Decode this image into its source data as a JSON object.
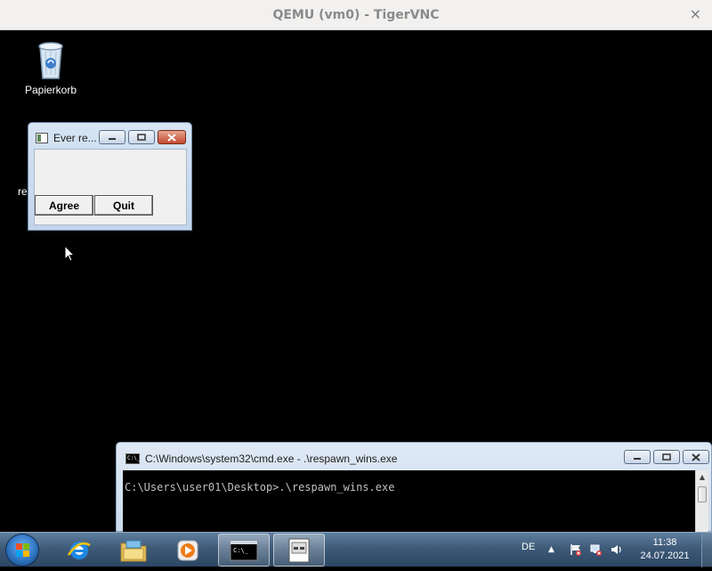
{
  "vnc": {
    "title": "QEMU (vm0) - TigerVNC",
    "close_glyph": "×"
  },
  "desktop": {
    "recycle_bin_label": "Papierkorb",
    "partial_icon_label": "re"
  },
  "dialog": {
    "title": "Ever re...",
    "agree_label": "Agree",
    "quit_label": "Quit"
  },
  "cmd": {
    "title": "C:\\Windows\\system32\\cmd.exe - .\\respawn_wins.exe",
    "line": "C:\\Users\\user01\\Desktop>.\\respawn_wins.exe",
    "icon_text": "C:\\_"
  },
  "taskbar": {
    "language": "DE",
    "time": "11:38",
    "date": "24.07.2021",
    "tray_arrow": "▲"
  },
  "icons": [
    "recycle-bin-icon",
    "windows-start-orb-icon",
    "internet-explorer-icon",
    "explorer-folder-icon",
    "media-player-icon",
    "cmd-icon",
    "window-app-icon",
    "flag-icon",
    "network-icon",
    "speaker-icon"
  ]
}
